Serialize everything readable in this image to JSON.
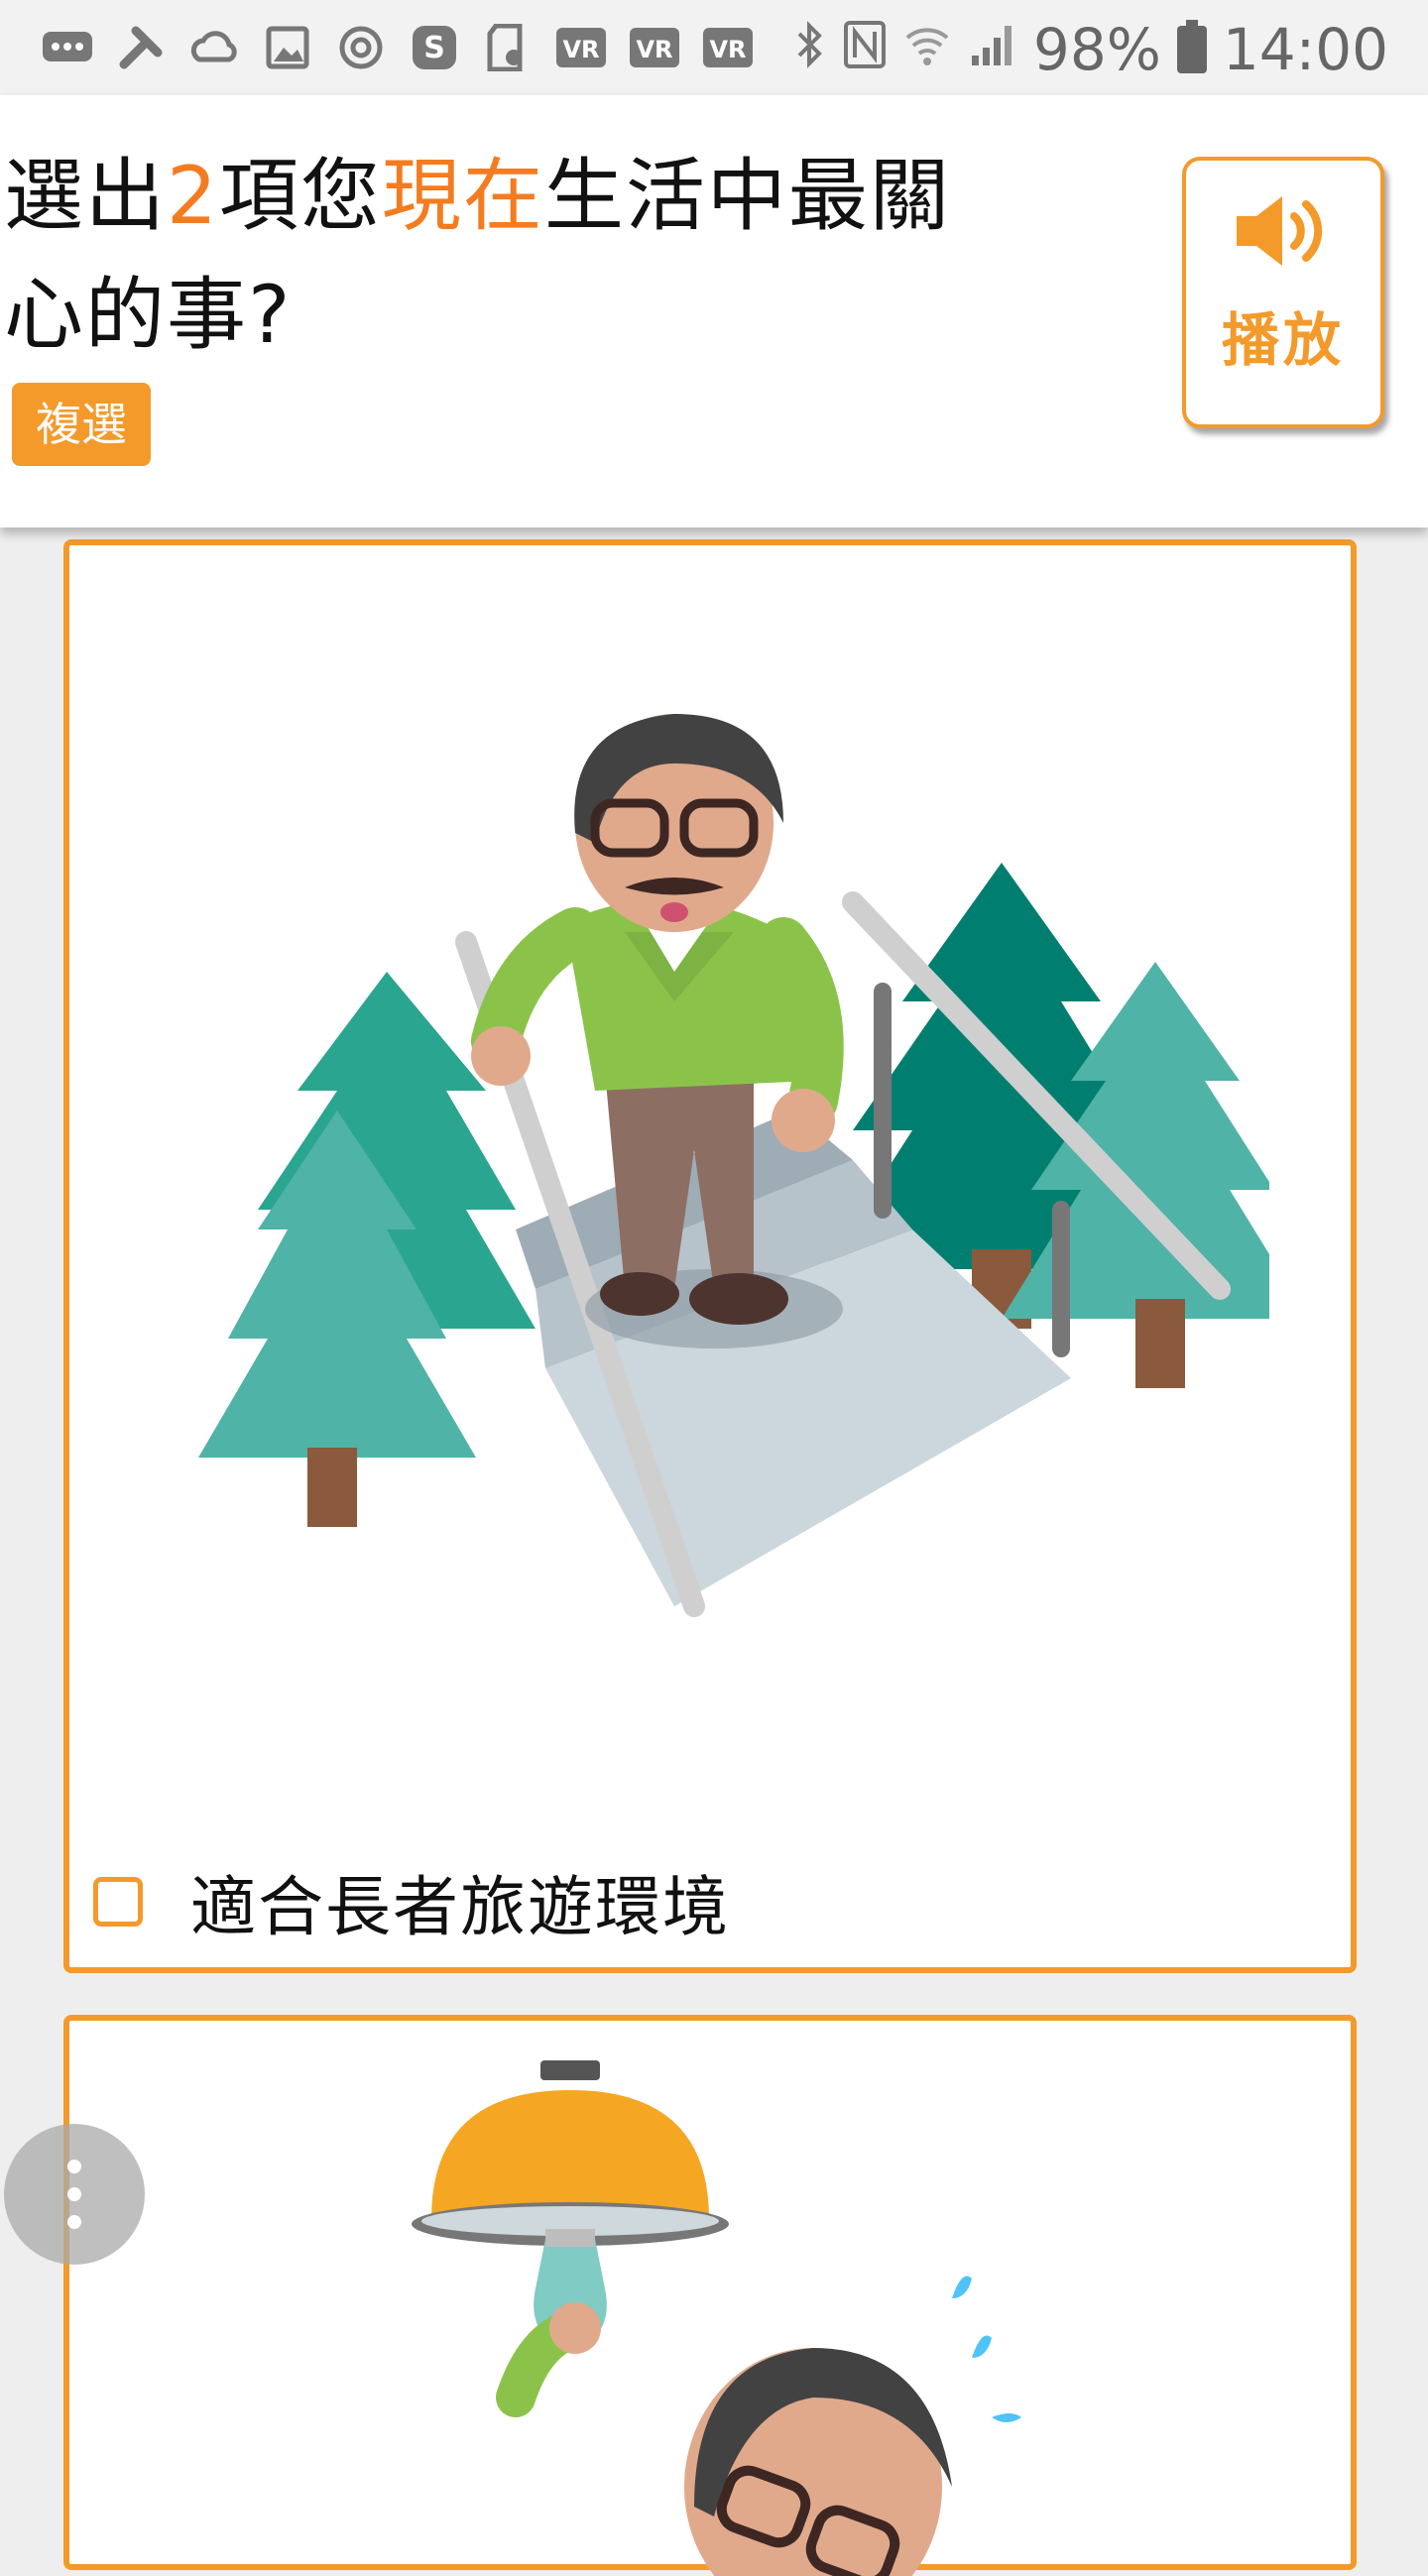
{
  "status_bar": {
    "battery": "98%",
    "time": "14:00",
    "vr_label": "VR",
    "icons": [
      "message-icon",
      "tools-icon",
      "cloud-sync-icon",
      "image-icon",
      "power-circle-icon",
      "skype-icon",
      "sd-card-icon",
      "vr-icon",
      "vr-icon",
      "vr-icon",
      "bluetooth-icon",
      "nfc-icon",
      "wifi-icon",
      "signal-icon",
      "battery-icon"
    ]
  },
  "question": {
    "part1": "選出",
    "count": "2",
    "part2": "項您",
    "highlight": "現在",
    "part3": "生活中最關心的事?"
  },
  "badge": "複選",
  "play_button": {
    "label": "播放",
    "icon": "speaker-icon"
  },
  "options": [
    {
      "label": "適合長者旅遊環境",
      "checked": false,
      "illustration": "elderly-man-stairs-forest"
    },
    {
      "label": "",
      "checked": false,
      "illustration": "elderly-man-changing-lightbulb"
    }
  ],
  "colors": {
    "accent": "#f39a2b",
    "highlight": "#f47c20"
  },
  "fab": {
    "icon": "more-vertical-icon"
  }
}
